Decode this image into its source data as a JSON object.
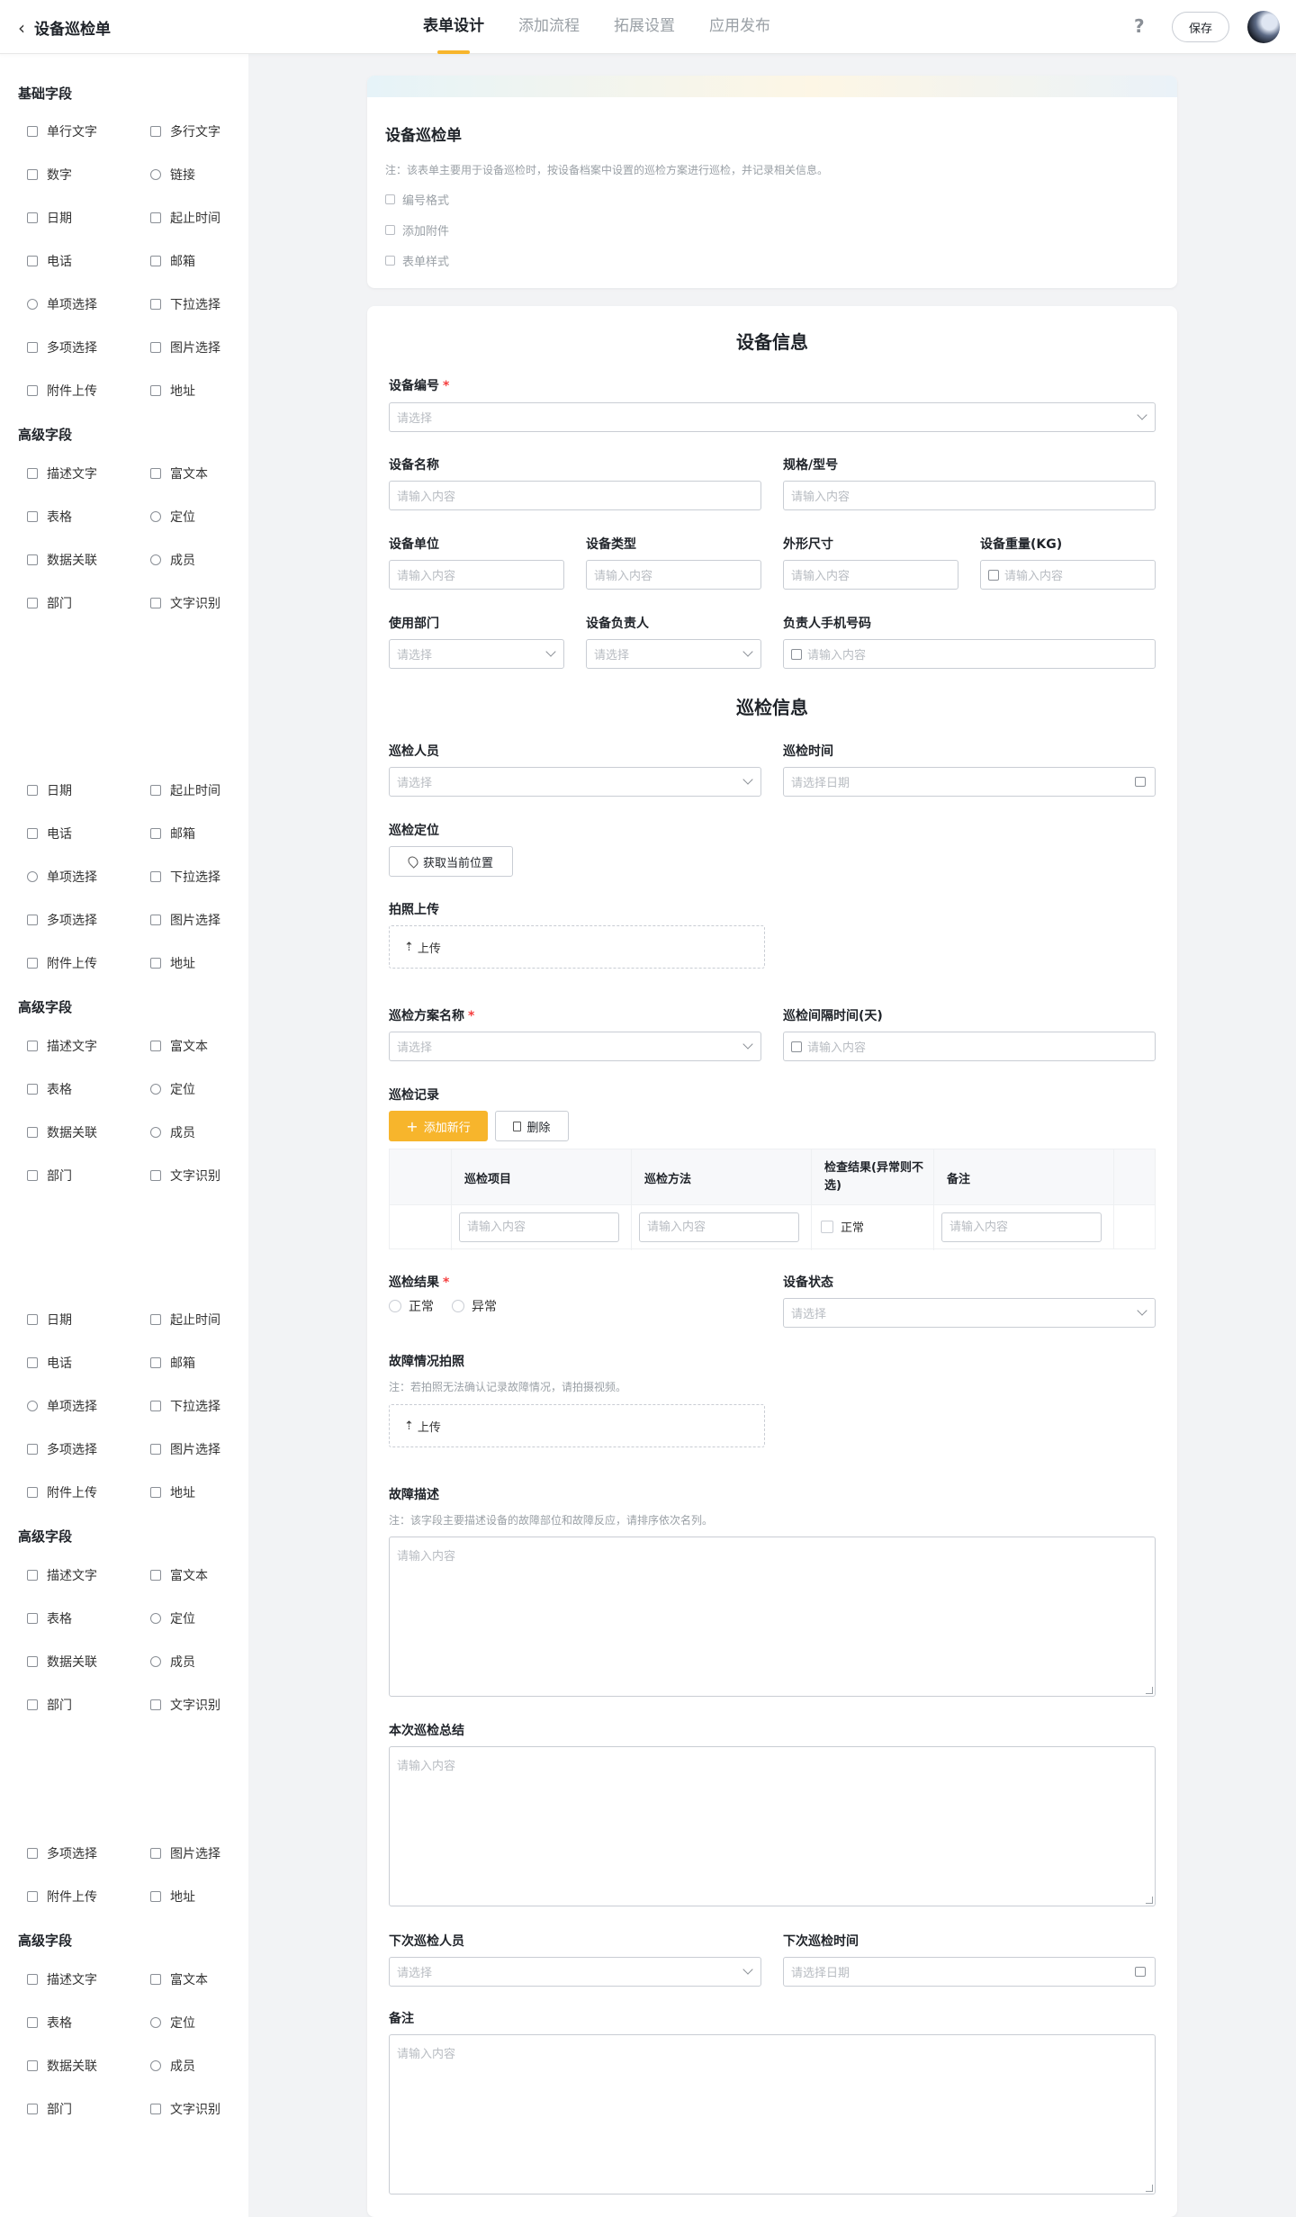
{
  "header": {
    "title": "设备巡检单",
    "tabs": [
      "表单设计",
      "添加流程",
      "拓展设置",
      "应用发布"
    ],
    "help": "?",
    "save": "保存"
  },
  "sidebar": {
    "basic": "基础字段",
    "advanced": "高级字段",
    "items": {
      "single_text": "单行文字",
      "multi_text": "多行文字",
      "number": "数字",
      "link": "链接",
      "date": "日期",
      "date_range": "起止时间",
      "phone": "电话",
      "email": "邮箱",
      "single_choice": "单项选择",
      "dropdown": "下拉选择",
      "multi_choice": "多项选择",
      "image_choice": "图片选择",
      "attachment": "附件上传",
      "address": "地址",
      "desc_text": "描述文字",
      "rich_text": "富文本",
      "table": "表格",
      "location": "定位",
      "data_link": "数据关联",
      "member": "成员",
      "department": "部门",
      "ocr": "文字识别"
    }
  },
  "intro": {
    "title": "设备巡检单",
    "note": "注：该表单主要用于设备巡检时，按设备档案中设置的巡检方案进行巡检，并记录相关信息。",
    "options": [
      "编号格式",
      "添加附件",
      "表单样式"
    ]
  },
  "form": {
    "section1": "设备信息",
    "section2": "巡检信息",
    "placeholder_input": "请输入内容",
    "placeholder_select": "请选择",
    "placeholder_date": "请选择日期",
    "labels": {
      "device_no": "设备编号",
      "device_name": "设备名称",
      "spec": "规格/型号",
      "unit": "设备单位",
      "type": "设备类型",
      "size": "外形尺寸",
      "weight": "设备重量(KG)",
      "dept": "使用部门",
      "owner": "设备负责人",
      "owner_phone": "负责人手机号码",
      "inspector": "巡检人员",
      "inspect_time": "巡检时间",
      "inspect_location": "巡检定位",
      "photo_upload": "拍照上传",
      "plan_name": "巡检方案名称",
      "interval": "巡检间隔时间(天)",
      "records": "巡检记录",
      "result": "巡检结果",
      "device_status": "设备状态",
      "fault_photo": "故障情况拍照",
      "fault_desc": "故障描述",
      "summary": "本次巡检总结",
      "next_inspector": "下次巡检人员",
      "next_time": "下次巡检时间",
      "remark": "备注"
    },
    "required_mark": "*",
    "get_location": "获取当前位置",
    "upload": "上传",
    "add_row": "添加新行",
    "delete": "删除",
    "table_headers": [
      "巡检项目",
      "巡检方法",
      "检查结果(异常则不选)",
      "备注"
    ],
    "check_normal": "正常",
    "result_options": [
      "正常",
      "异常"
    ],
    "fault_photo_note": "注：若拍照无法确认记录故障情况，请拍摄视频。",
    "fault_desc_note": "注：该字段主要描述设备的故障部位和故障反应，请排序依次名列。"
  }
}
